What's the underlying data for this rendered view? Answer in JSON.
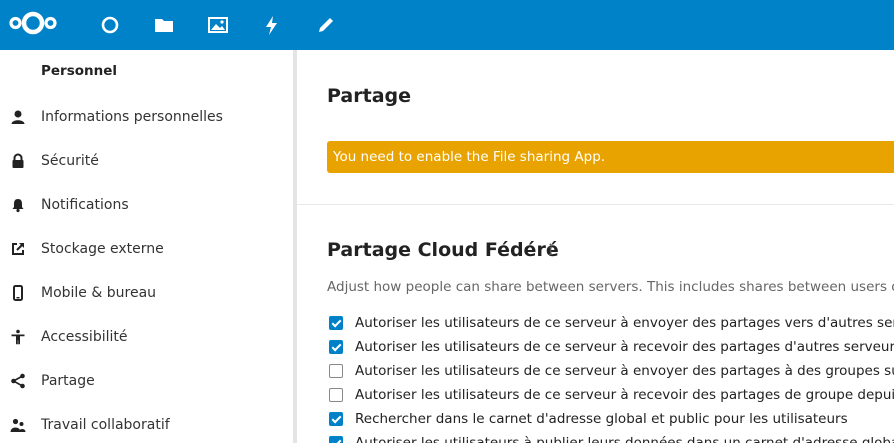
{
  "colors": {
    "header": "#0082c9",
    "accent": "#0082c9",
    "warning": "#e9a300"
  },
  "topnav": {
    "logo_icon": "nextcloud-logo",
    "apps": [
      {
        "icon": "dashboard-icon"
      },
      {
        "icon": "files-icon"
      },
      {
        "icon": "photos-icon"
      },
      {
        "icon": "activity-icon"
      },
      {
        "icon": "notes-icon"
      }
    ]
  },
  "sidebar": {
    "caption": "Personnel",
    "items": [
      {
        "label": "Informations personnelles",
        "icon": "user-icon"
      },
      {
        "label": "Sécurité",
        "icon": "lock-icon"
      },
      {
        "label": "Notifications",
        "icon": "bell-icon"
      },
      {
        "label": "Stockage externe",
        "icon": "external-link-icon"
      },
      {
        "label": "Mobile & bureau",
        "icon": "phone-icon"
      },
      {
        "label": "Accessibilité",
        "icon": "accessibility-icon"
      },
      {
        "label": "Partage",
        "icon": "share-icon"
      },
      {
        "label": "Travail collaboratif",
        "icon": "collaboration-icon"
      }
    ]
  },
  "main": {
    "sharing_title": "Partage",
    "warning": "You need to enable the File sharing App.",
    "federated_title": "Partage Cloud Fédéré",
    "info_icon": "info-icon",
    "description": "Adjust how people can share between servers. This includes shares between users o",
    "options": [
      {
        "label": "Autoriser les utilisateurs de ce serveur à envoyer des partages vers d'autres serv",
        "checked": true
      },
      {
        "label": "Autoriser les utilisateurs de ce serveur à recevoir des partages d'autres serveurs",
        "checked": true
      },
      {
        "label": "Autoriser les utilisateurs de ce serveur à envoyer des partages à des groupes sur",
        "checked": false
      },
      {
        "label": "Autoriser les utilisateurs de ce serveur à recevoir des partages de groupe depuis",
        "checked": false
      },
      {
        "label": "Rechercher dans le carnet d'adresse global et public pour les utilisateurs",
        "checked": true
      },
      {
        "label": "Autoriser les utilisateurs à publier leurs données dans un carnet d'adresse global",
        "checked": true
      }
    ]
  }
}
